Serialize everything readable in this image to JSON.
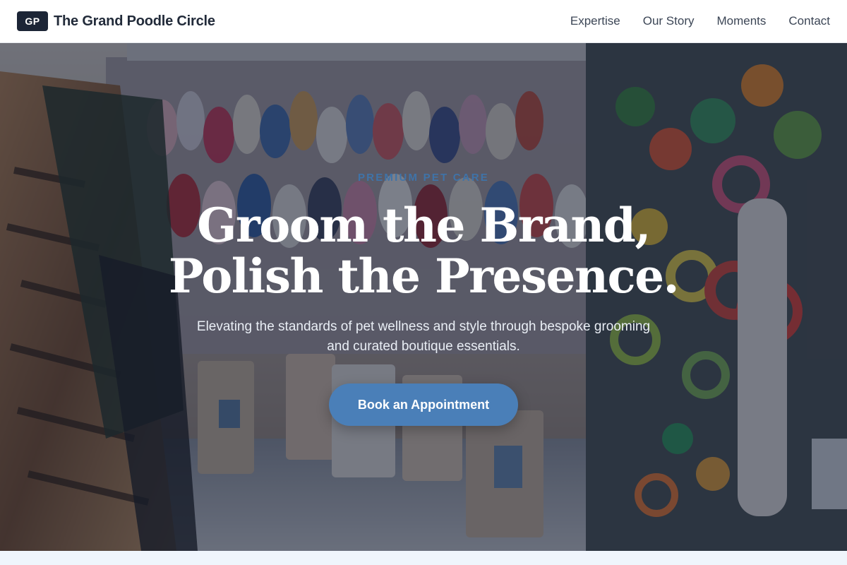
{
  "header": {
    "logo_mark": "GP",
    "brand_name": "The Grand Poodle Circle",
    "nav": [
      {
        "label": "Expertise"
      },
      {
        "label": "Our Story"
      },
      {
        "label": "Moments"
      },
      {
        "label": "Contact"
      }
    ]
  },
  "hero": {
    "eyebrow": "PREMIUM PET CARE",
    "headline_line1": "Groom the Brand,",
    "headline_line2": "Polish the Presence.",
    "subtext": "Elevating the standards of pet wellness and style through bespoke grooming and curated boutique essentials.",
    "cta_label": "Book an Appointment"
  },
  "colors": {
    "brand_dark": "#1c2536",
    "accent": "#4a7fb8",
    "eyebrow": "#3f73a8",
    "page_bg": "#eff5fc"
  }
}
